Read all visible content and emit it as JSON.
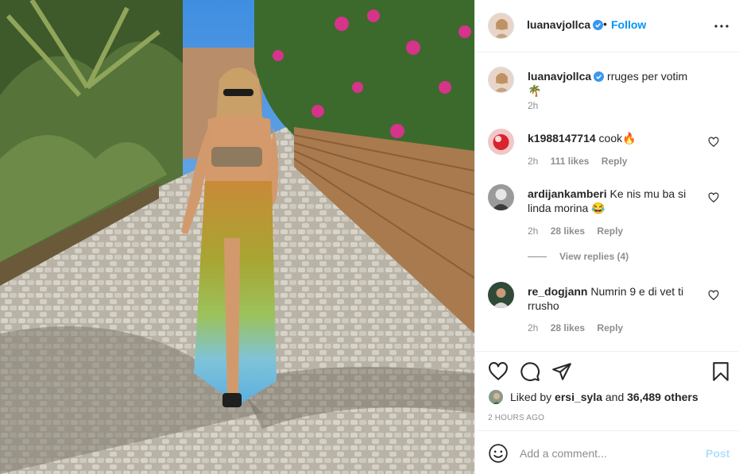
{
  "post": {
    "author": "luanavjollca",
    "separator": "•",
    "follow_label": "Follow",
    "verified_icon": "verified-badge-icon",
    "more_icon": "more-options-icon"
  },
  "caption": {
    "username": "luanavjollca",
    "text": "rruges per votim 🌴",
    "time": "2h"
  },
  "comments": [
    {
      "username": "k1988147714",
      "text": "cook🔥",
      "time": "2h",
      "likes": "111 likes",
      "reply": "Reply"
    },
    {
      "username": "ardijankamberi",
      "text": "Ke nis mu ba si linda morina 😂",
      "time": "2h",
      "likes": "28 likes",
      "reply": "Reply"
    },
    {
      "username": "re_dogjann",
      "text": "Numrin 9 e di vet ti rrusho",
      "time": "2h",
      "likes": "28 likes",
      "reply": "Reply"
    }
  ],
  "view_replies": "View replies (4)",
  "liked_by": {
    "prefix": "Liked by",
    "user": "ersi_syla",
    "middle": "and",
    "count": "36,489 others"
  },
  "timestamp": "2 HOURS AGO",
  "add_comment": {
    "placeholder": "Add a comment...",
    "post_label": "Post"
  },
  "colors": {
    "accent": "#0095f6",
    "post_disabled": "#b2dffc",
    "muted": "#8e8e8e"
  }
}
